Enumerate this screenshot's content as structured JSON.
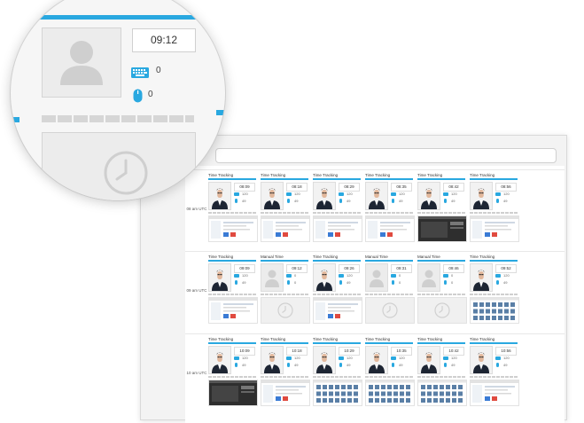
{
  "colors": {
    "accent": "#29a8e0",
    "placeholder": "#cfcfcf"
  },
  "magnifier": {
    "time": "09:12",
    "keyboard_count": "0",
    "mouse_count": "0",
    "avatar_icon": "user-placeholder-icon",
    "clock_icon": "clock-icon"
  },
  "timeline": {
    "hours": [
      {
        "label": "08 am UTC",
        "cards": [
          {
            "title": "Time Tracking",
            "time": "08:09",
            "kb": "120",
            "ms": "49",
            "kind": "photo",
            "shot": "web"
          },
          {
            "title": "Time Tracking",
            "time": "08:18",
            "kb": "120",
            "ms": "49",
            "kind": "photo",
            "shot": "web"
          },
          {
            "title": "Time Tracking",
            "time": "08:29",
            "kb": "120",
            "ms": "49",
            "kind": "photo",
            "shot": "web"
          },
          {
            "title": "Time Tracking",
            "time": "08:35",
            "kb": "120",
            "ms": "49",
            "kind": "photo",
            "shot": "web"
          },
          {
            "title": "Time Tracking",
            "time": "08:42",
            "kb": "120",
            "ms": "49",
            "kind": "photo",
            "shot": "dark"
          },
          {
            "title": "Time Tracking",
            "time": "08:56",
            "kb": "120",
            "ms": "49",
            "kind": "photo",
            "shot": "web"
          }
        ]
      },
      {
        "label": "09 am UTC",
        "cards": [
          {
            "title": "Time Tracking",
            "time": "09:09",
            "kb": "120",
            "ms": "49",
            "kind": "photo",
            "shot": "web"
          },
          {
            "title": "Manual Time",
            "time": "09:12",
            "kb": "0",
            "ms": "0",
            "kind": "manual",
            "shot": "clock"
          },
          {
            "title": "Time Tracking",
            "time": "09:26",
            "kb": "120",
            "ms": "49",
            "kind": "photo",
            "shot": "web"
          },
          {
            "title": "Manual Time",
            "time": "09:31",
            "kb": "0",
            "ms": "0",
            "kind": "manual",
            "shot": "clock"
          },
          {
            "title": "Manual Time",
            "time": "09:46",
            "kb": "0",
            "ms": "0",
            "kind": "manual",
            "shot": "clock"
          },
          {
            "title": "Time Tracking",
            "time": "09:52",
            "kb": "120",
            "ms": "49",
            "kind": "photo",
            "shot": "grid"
          }
        ]
      },
      {
        "label": "10 am UTC",
        "cards": [
          {
            "title": "Time Tracking",
            "time": "10:09",
            "kb": "120",
            "ms": "49",
            "kind": "photo",
            "shot": "dark"
          },
          {
            "title": "Time Tracking",
            "time": "10:18",
            "kb": "120",
            "ms": "49",
            "kind": "photo",
            "shot": "web"
          },
          {
            "title": "Time Tracking",
            "time": "10:29",
            "kb": "120",
            "ms": "49",
            "kind": "photo",
            "shot": "grid"
          },
          {
            "title": "Time Tracking",
            "time": "10:35",
            "kb": "120",
            "ms": "49",
            "kind": "photo",
            "shot": "grid"
          },
          {
            "title": "Time Tracking",
            "time": "10:42",
            "kb": "120",
            "ms": "49",
            "kind": "photo",
            "shot": "grid"
          },
          {
            "title": "Time Tracking",
            "time": "10:56",
            "kb": "120",
            "ms": "49",
            "kind": "photo",
            "shot": "web"
          }
        ]
      }
    ]
  }
}
